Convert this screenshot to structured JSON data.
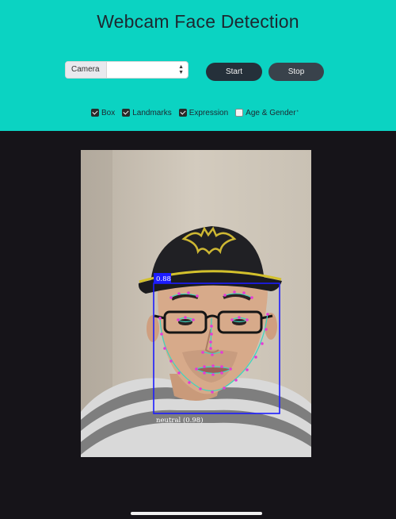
{
  "header": {
    "title": "Webcam Face Detection"
  },
  "controls": {
    "source_select": {
      "value": "Camera"
    },
    "start_label": "Start",
    "stop_label": "Stop"
  },
  "options": [
    {
      "label": "Box",
      "checked": true
    },
    {
      "label": "Landmarks",
      "checked": true
    },
    {
      "label": "Expression",
      "checked": true
    },
    {
      "label": "Age & Gender",
      "checked": false,
      "marker": "*"
    }
  ],
  "detection": {
    "score": "0.88",
    "expression": "neutral (0.98)",
    "box_color": "#1c1cff",
    "contour_color": "#3cd5c0",
    "landmark_color": "#e63ad6"
  },
  "colors": {
    "header_bg": "#0bd3c2",
    "page_bg": "#161419",
    "button_dark": "#25303a"
  },
  "icons": {
    "select_arrow": "chevron-updown-icon",
    "cap_logo": "bat-logo"
  }
}
